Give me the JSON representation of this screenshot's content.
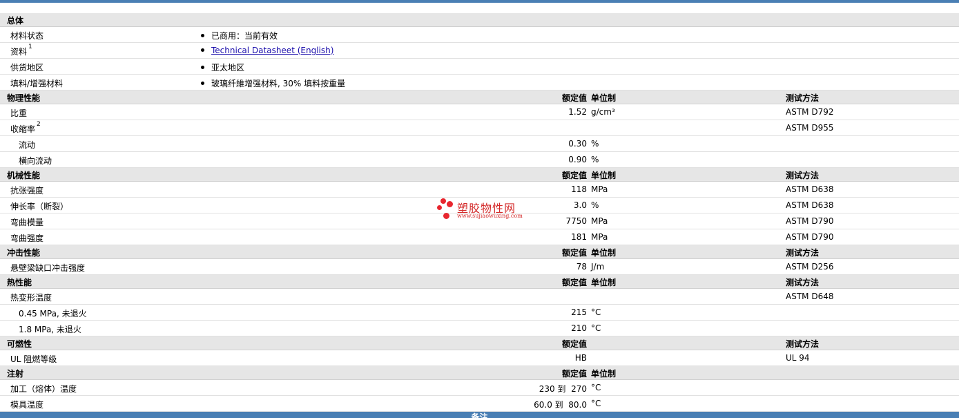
{
  "sections": {
    "general": {
      "title": "总体",
      "rows": [
        {
          "label": "材料状态",
          "value": "已商用：当前有效"
        },
        {
          "label": "资料",
          "sup": "1",
          "value": "Technical Datasheet (English)"
        },
        {
          "label": "供货地区",
          "value": "亚太地区"
        },
        {
          "label": "填料/增强材料",
          "value": "玻璃纤維增强材料, 30% 填料按重量"
        }
      ]
    },
    "physical": {
      "title": "物理性能",
      "h_value": "额定值",
      "h_unit": "单位制",
      "h_test": "测试方法",
      "rows": [
        {
          "label": "比重",
          "value": "1.52",
          "unit": "g/cm³",
          "test": "ASTM D792"
        },
        {
          "label": "收缩率",
          "sup": "2",
          "value": "",
          "unit": "",
          "test": "ASTM D955"
        },
        {
          "label": "流动",
          "value": "0.30",
          "unit": "%",
          "test": ""
        },
        {
          "label": "横向流动",
          "value": "0.90",
          "unit": "%",
          "test": ""
        }
      ]
    },
    "mechanical": {
      "title": "机械性能",
      "h_value": "额定值",
      "h_unit": "单位制",
      "h_test": "测试方法",
      "rows": [
        {
          "label": "抗张强度",
          "value": "118",
          "unit": "MPa",
          "test": "ASTM D638"
        },
        {
          "label": "伸长率（断裂）",
          "value": "3.0",
          "unit": "%",
          "test": "ASTM D638"
        },
        {
          "label": "弯曲模量",
          "value": "7750",
          "unit": "MPa",
          "test": "ASTM D790"
        },
        {
          "label": "弯曲强度",
          "value": "181",
          "unit": "MPa",
          "test": "ASTM D790"
        }
      ]
    },
    "impact": {
      "title": "冲击性能",
      "h_value": "额定值",
      "h_unit": "单位制",
      "h_test": "测试方法",
      "rows": [
        {
          "label": "悬壁梁缺口冲击强度",
          "value": "78",
          "unit": "J/m",
          "test": "ASTM D256"
        }
      ]
    },
    "thermal": {
      "title": "热性能",
      "h_value": "额定值",
      "h_unit": "单位制",
      "h_test": "测试方法",
      "rows": [
        {
          "label": "热变形温度",
          "value": "",
          "unit": "",
          "test": "ASTM D648"
        },
        {
          "label": "0.45 MPa, 未退火",
          "value": "215",
          "unit": "°C",
          "test": ""
        },
        {
          "label": "1.8 MPa, 未退火",
          "value": "210",
          "unit": "°C",
          "test": ""
        }
      ]
    },
    "flammability": {
      "title": "可燃性",
      "h_value": "额定值",
      "h_test": "测试方法",
      "rows": [
        {
          "label": "UL 阻燃等级",
          "value": "HB",
          "test": "UL 94"
        }
      ]
    },
    "injection": {
      "title": "注射",
      "h_value": "额定值",
      "h_unit": "单位制",
      "rows": [
        {
          "label": "加工（熔体）温度",
          "value": "230 到  270",
          "unit": "°C"
        },
        {
          "label": "模具温度",
          "value": "60.0 到  80.0",
          "unit": "°C"
        }
      ]
    }
  },
  "watermark": {
    "name": "塑胶物性网",
    "url": "www.sujiaowuxing.com"
  },
  "footer": {
    "title": "备注"
  },
  "colors": {
    "header_bg": "#e6e6e6",
    "bar": "#4a7fb4",
    "link": "#1a0dab",
    "watermark": "#e8262f"
  }
}
